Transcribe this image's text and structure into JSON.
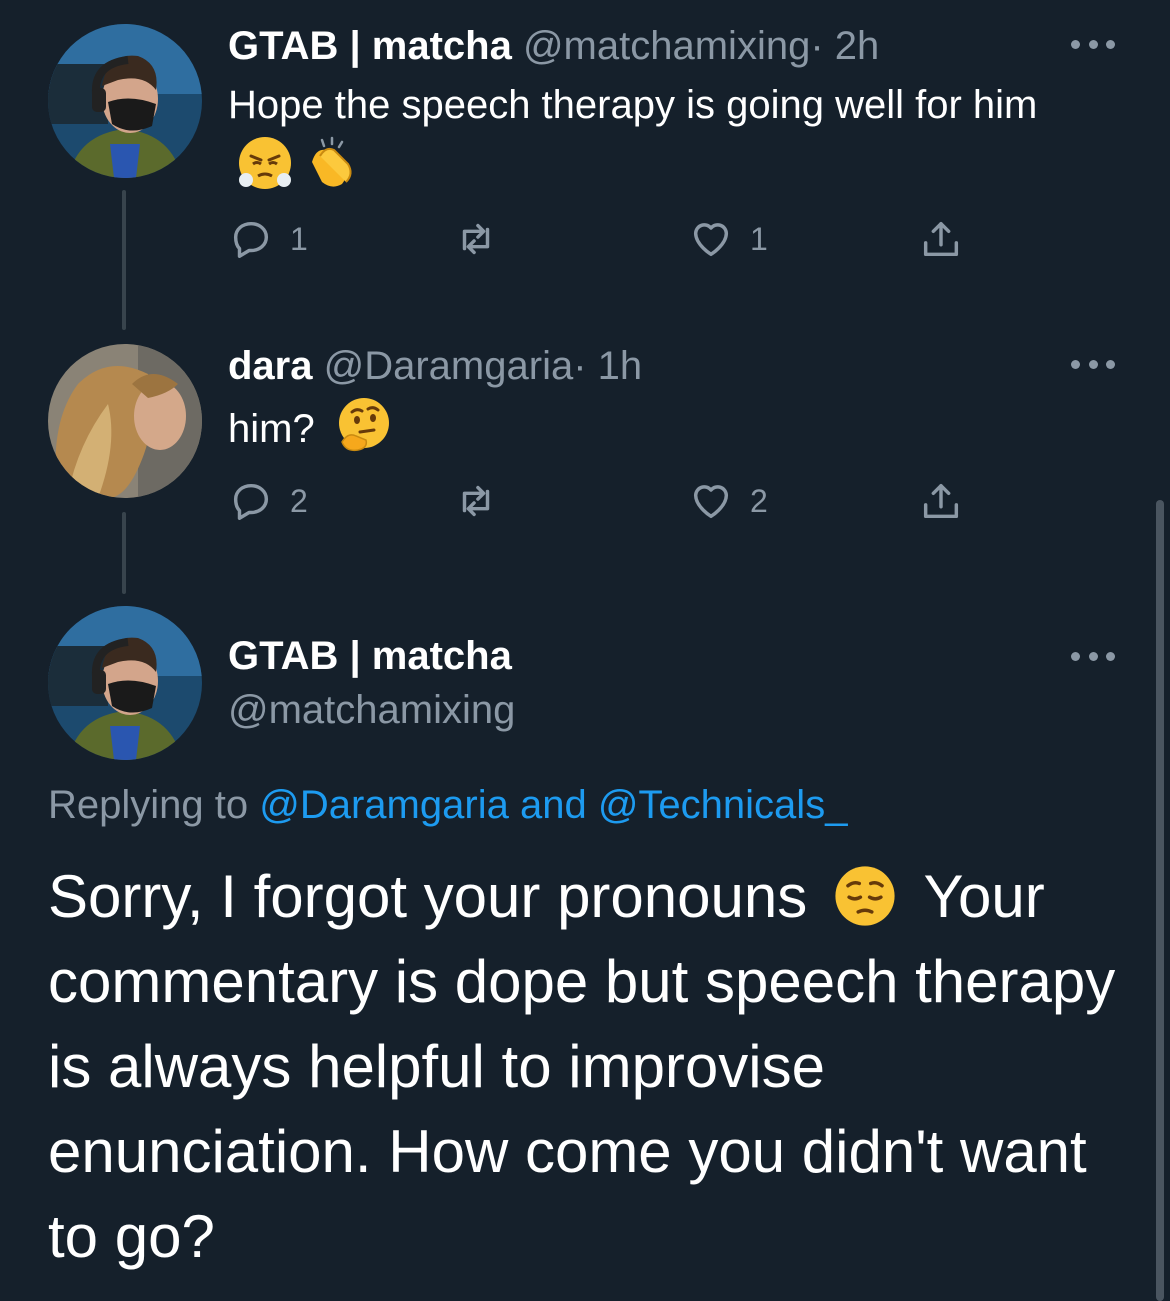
{
  "theme": {
    "background": "#15202b",
    "accent": "#1d9bf0",
    "muted": "#8b98a5"
  },
  "tweets": [
    {
      "name": "GTAB | matcha",
      "handle": "@matchamixing",
      "time": "· 2h",
      "text": "Hope the speech therapy is going well for him",
      "emojis": [
        "face-with-steam-emoji",
        "clapping-hands-emoji"
      ],
      "reply_count": "1",
      "like_count": "1"
    },
    {
      "name": "dara",
      "handle": "@Daramgaria",
      "time": "· 1h",
      "text": "him?",
      "emojis": [
        "thinking-face-emoji"
      ],
      "reply_count": "2",
      "like_count": "2"
    }
  ],
  "main": {
    "name": "GTAB | matcha",
    "handle": "@matchamixing",
    "replying_prefix": "Replying to",
    "reply_to_1": "@Daramgaria",
    "reply_and": "and",
    "reply_to_2": "@Technicals_",
    "text_part1": "Sorry, I forgot your pronouns",
    "text_part2": "Your commentary is dope but speech therapy is always helpful to improvise enunciation. How come you didn't want to go?",
    "emoji": "pensive-face-emoji"
  }
}
